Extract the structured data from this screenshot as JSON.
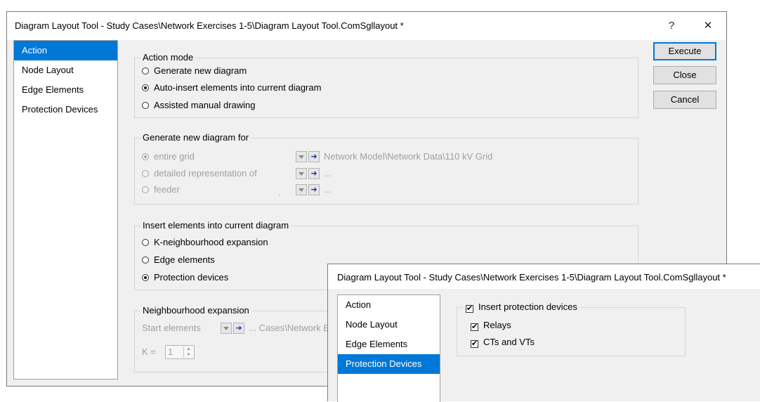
{
  "main_window": {
    "title": "Diagram Layout Tool - Study Cases\\Network Exercises 1-5\\Diagram Layout Tool.ComSgllayout *",
    "help_glyph": "?",
    "close_glyph": "✕",
    "nav": [
      {
        "label": "Action",
        "selected": true
      },
      {
        "label": "Node Layout",
        "selected": false
      },
      {
        "label": "Edge Elements",
        "selected": false
      },
      {
        "label": "Protection Devices",
        "selected": false
      }
    ],
    "buttons": {
      "execute": "Execute",
      "close": "Close",
      "cancel": "Cancel"
    },
    "action_mode": {
      "label": "Action mode",
      "options": [
        {
          "label": "Generate new diagram",
          "checked": false
        },
        {
          "label": "Auto-insert elements into current diagram",
          "checked": true
        },
        {
          "label": "Assisted manual drawing",
          "checked": false
        }
      ]
    },
    "generate_for": {
      "label": "Generate new diagram for",
      "options": [
        {
          "label": "entire grid",
          "checked": true,
          "path": "Network Model\\Network Data\\110 kV Grid"
        },
        {
          "label": "detailed representation of",
          "checked": false,
          "path": "..."
        },
        {
          "label": "feeder",
          "checked": false,
          "path": "..."
        }
      ],
      "dot": "."
    },
    "insert_elements": {
      "label": "Insert elements into current diagram",
      "options": [
        {
          "label": "K-neighbourhood expansion",
          "checked": false
        },
        {
          "label": "Edge elements",
          "checked": false
        },
        {
          "label": "Protection devices",
          "checked": true
        }
      ]
    },
    "neighbourhood": {
      "label": "Neighbourhood expansion",
      "start_label": "Start elements",
      "start_path": "... Cases\\Network E",
      "k_label": "K =",
      "k_value": "1"
    }
  },
  "overlay_window": {
    "title": "Diagram Layout Tool - Study Cases\\Network Exercises 1-5\\Diagram Layout Tool.ComSgllayout *",
    "nav": [
      {
        "label": "Action",
        "selected": false
      },
      {
        "label": "Node Layout",
        "selected": false
      },
      {
        "label": "Edge Elements",
        "selected": false
      },
      {
        "label": "Protection Devices",
        "selected": true
      }
    ],
    "insert_protection": {
      "label": "Insert protection devices",
      "checked": true
    },
    "relays": {
      "label": "Relays",
      "checked": true
    },
    "cts_vts": {
      "label": "CTs and VTs",
      "checked": true
    }
  },
  "icons": {
    "dropdown": "chevron-down-icon",
    "select_arrow": "arrow-right-icon",
    "check_mark": "✔"
  },
  "colors": {
    "selection": "#0078d7",
    "disabled_text": "#a0a0a0",
    "dialog_bg": "#f0f0f0"
  }
}
